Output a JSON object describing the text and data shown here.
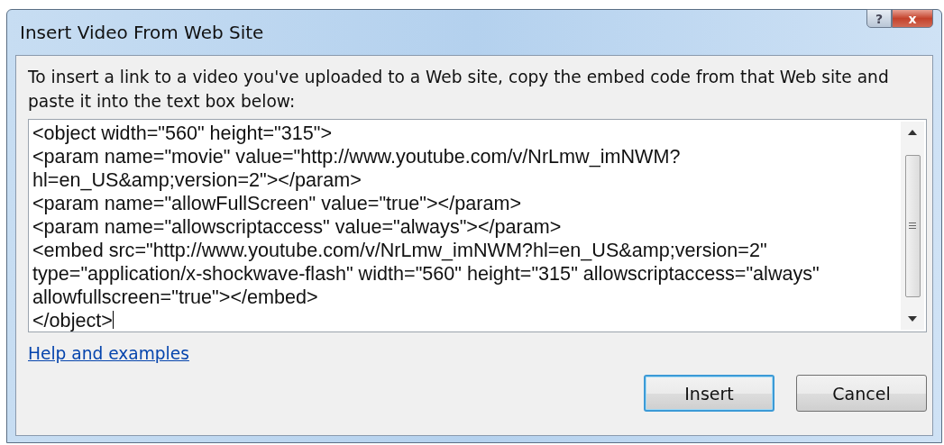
{
  "window": {
    "title": "Insert Video From Web Site",
    "help_button": "?",
    "close_button": "x"
  },
  "instructions": "To insert a link to a video you've uploaded to a Web site, copy the embed code from that Web site and paste it into the text box below:",
  "code_box": {
    "lines": [
      "<object width=\"560\" height=\"315\">",
      "<param name=\"movie\" value=\"http://www.youtube.com/v/NrLmw_imNWM?",
      "hl=en_US&amp;version=2\"></param>",
      "<param name=\"allowFullScreen\" value=\"true\"></param>",
      "<param name=\"allowscriptaccess\" value=\"always\"></param>",
      "<embed src=\"http://www.youtube.com/v/NrLmw_imNWM?hl=en_US&amp;version=2\"",
      "type=\"application/x-shockwave-flash\" width=\"560\" height=\"315\" allowscriptaccess=\"always\"",
      "allowfullscreen=\"true\"></embed>",
      "</object>"
    ]
  },
  "help_link": "Help and examples",
  "buttons": [
    {
      "label": "Insert",
      "default": true
    },
    {
      "label": "Cancel",
      "default": false
    }
  ]
}
